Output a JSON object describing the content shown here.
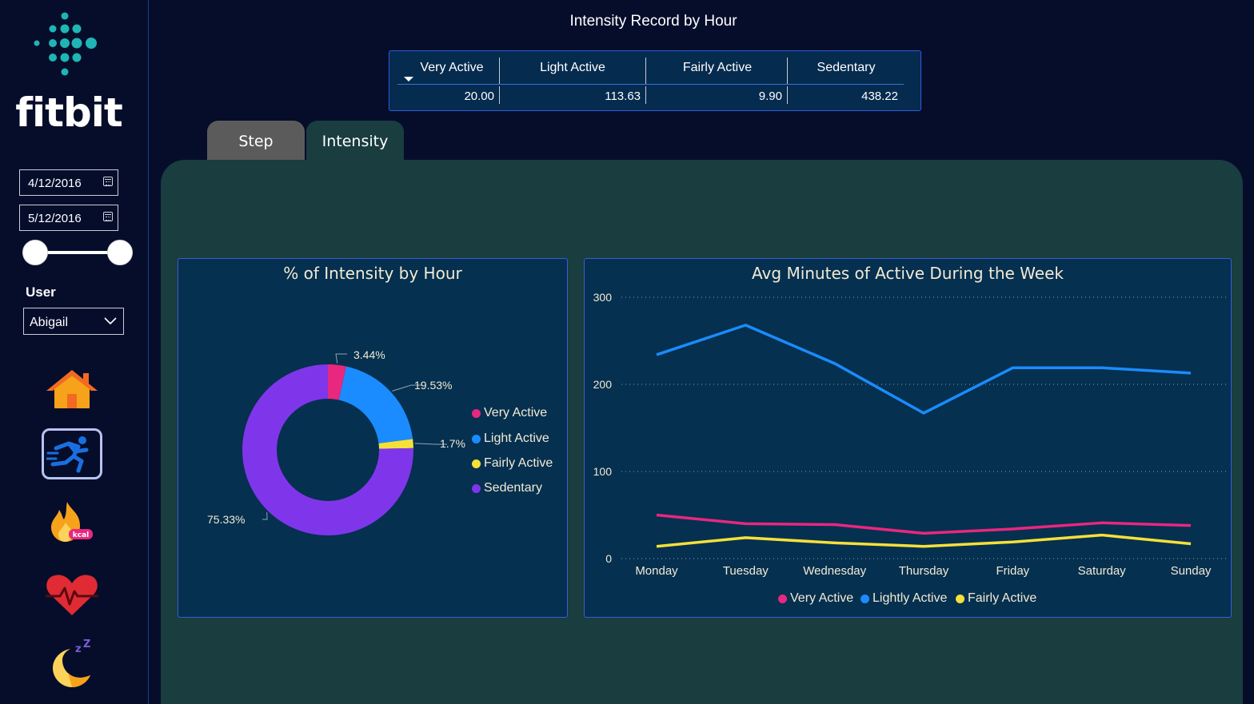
{
  "brand": {
    "name": "fitbit"
  },
  "filters": {
    "start_date": "4/12/2016",
    "end_date": "5/12/2016",
    "user_label": "User",
    "user_value": "Abigail"
  },
  "nav": {
    "items": [
      "home-icon",
      "activity-runner-icon",
      "calories-flame-icon",
      "heart-rate-icon",
      "sleep-moon-icon"
    ],
    "active_index": 1,
    "kcal_badge": "kcal"
  },
  "header": {
    "title": "Intensity Record by Hour"
  },
  "kpi_table": {
    "columns": [
      "Very Active",
      "Light Active",
      "Fairly Active",
      "Sedentary"
    ],
    "values": [
      "20.00",
      "113.63",
      "9.90",
      "438.22"
    ]
  },
  "tabs": [
    {
      "label": "Step",
      "active": false
    },
    {
      "label": "Intensity",
      "active": true
    }
  ],
  "donut_card": {
    "title": "% of Intensity by Hour",
    "labels": [
      "3.44%",
      "19.53%",
      "1.7%",
      "75.33%"
    ],
    "legend": [
      "Very Active",
      "Light Active",
      "Fairly Active",
      "Sedentary"
    ]
  },
  "line_card": {
    "title": "Avg Minutes of Active During the Week",
    "legend": [
      "Very Active",
      "Lightly Active",
      "Fairly Active"
    ]
  },
  "colors": {
    "very_active": "#e8277f",
    "light_active": "#1a8cff",
    "fairly_active": "#f5e03a",
    "sedentary": "#7f36ea",
    "brand_teal": "#1fb5b5",
    "background": "#060d2b",
    "panel": "#1a3d3f",
    "card": "#05304f"
  },
  "chart_data": [
    {
      "type": "pie",
      "title": "% of Intensity by Hour",
      "categories": [
        "Very Active",
        "Light Active",
        "Fairly Active",
        "Sedentary"
      ],
      "values": [
        3.44,
        19.53,
        1.7,
        75.33
      ],
      "donut": true,
      "legend": "right"
    },
    {
      "type": "line",
      "title": "Avg Minutes of Active During the Week",
      "categories": [
        "Monday",
        "Tuesday",
        "Wednesday",
        "Thursday",
        "Friday",
        "Saturday",
        "Sunday"
      ],
      "series": [
        {
          "name": "Very Active",
          "values": [
            50,
            40,
            39,
            29,
            34,
            41,
            38
          ]
        },
        {
          "name": "Lightly Active",
          "values": [
            234,
            268,
            224,
            167,
            219,
            219,
            213
          ]
        },
        {
          "name": "Fairly Active",
          "values": [
            14,
            24,
            18,
            14,
            19,
            27,
            17
          ]
        }
      ],
      "yticks": [
        "0",
        "100",
        "200",
        "300"
      ],
      "ylim": [
        0,
        300
      ],
      "grid": true,
      "legend": "bottom"
    }
  ]
}
